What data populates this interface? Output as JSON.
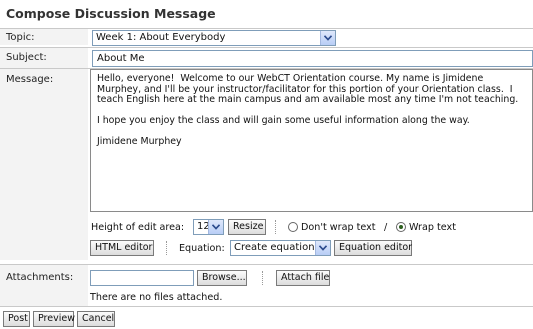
{
  "page_title": "Compose Discussion Message",
  "topic": {
    "label": "Topic:",
    "value": "Week 1: About Everybody"
  },
  "subject": {
    "label": "Subject:",
    "value": "About Me"
  },
  "message": {
    "label": "Message:",
    "paragraphs": [
      "Hello, everyone!  Welcome to our WebCT Orientation course. My name is Jimidene Murphey, and I'll be your instructor/facilitator for this portion of your Orientation class.  I teach English here at the main campus and am available most any time I'm not teaching.",
      "I hope you enjoy the class and will gain some useful information along the way.",
      "Jimidene Murphey"
    ]
  },
  "edit_area": {
    "height_label": "Height of edit area:",
    "height_value": "12",
    "resize_label": "Resize",
    "dont_wrap_label": "Don't wrap text",
    "slash": "/",
    "wrap_label": "Wrap text",
    "wrap_selected": "wrap"
  },
  "editor_row": {
    "html_editor_label": "HTML editor",
    "equation_label": "Equation:",
    "equation_value": "Create equation",
    "equation_editor_label": "Equation editor"
  },
  "attachments": {
    "label": "Attachments:",
    "file_value": "",
    "browse_label": "Browse...",
    "attach_label": "Attach file",
    "status": "There are no files attached."
  },
  "actions": {
    "post": "Post",
    "preview": "Preview",
    "cancel": "Cancel"
  }
}
